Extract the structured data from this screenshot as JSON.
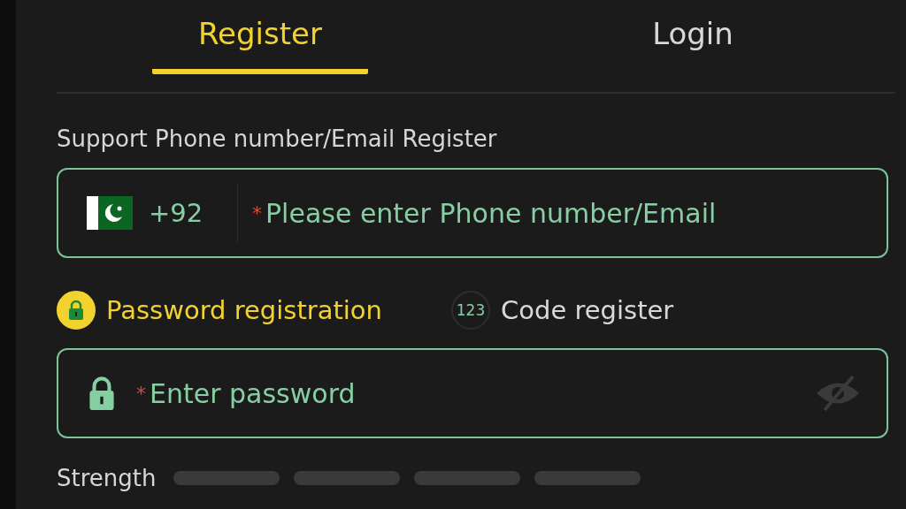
{
  "tabs": [
    {
      "label": "Register",
      "selected": true
    },
    {
      "label": "Login",
      "selected": false
    }
  ],
  "support_label": "Support Phone number/Email Register",
  "phone_field": {
    "country_code": "+92",
    "required_mark": "*",
    "placeholder": "Please enter Phone number/Email"
  },
  "methods": [
    {
      "kind": "lock",
      "label": "Password registration",
      "selected": true
    },
    {
      "kind": "code",
      "icon_text": "123",
      "label": "Code register",
      "selected": false
    }
  ],
  "password_field": {
    "required_mark": "*",
    "placeholder": "Enter password",
    "visible": false
  },
  "strength": {
    "label": "Strength",
    "segments": [
      {
        "filled": false
      },
      {
        "filled": false
      },
      {
        "filled": false
      },
      {
        "filled": false
      }
    ]
  }
}
